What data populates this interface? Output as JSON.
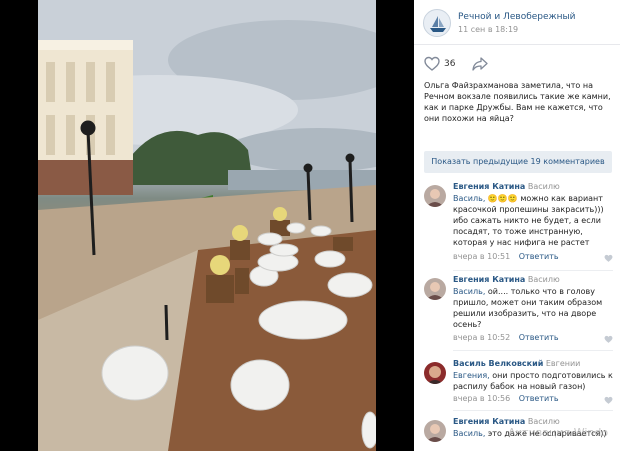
{
  "post": {
    "group_name": "Речной и Левобережный",
    "date": "11 сен в 18:19",
    "likes": "36",
    "text": "Ольга Файзрахманова заметила, что на Речном вокзале появились такие же камни, как и парке Дружбы. Вам не кажется, что они похожи на яйца?"
  },
  "comments_section": {
    "show_previous": "Показать предыдущие 19 комментариев",
    "items": [
      {
        "author": "Евгения Катина",
        "reply_to": "Василю",
        "mention": "Василь,",
        "text": "🙂🙂🙂 можно как вариант красочкой пропешины закрасить))) ибо сажать никто не будет, а если посадят, то тоже инстранную, которая у нас нифига не растет",
        "time": "вчера в 10:51",
        "answer": "Ответить"
      },
      {
        "author": "Евгения Катина",
        "reply_to": "Василю",
        "mention": "Василь,",
        "text": "ой.... только что в голову пришло, может они таким образом решили изобразить, что на дворе осень?",
        "time": "вчера в 10:52",
        "answer": "Ответить"
      },
      {
        "author": "Василь Велковский",
        "reply_to": "Евгении",
        "mention": "Евгения,",
        "text": "они просто подготовились к распилу бабок на новый газон)",
        "time": "вчера в 10:56",
        "answer": "Ответить"
      },
      {
        "author": "Евгения Катина",
        "reply_to": "Василю",
        "mention": "Василь,",
        "text": "это даже не оспаривается))",
        "time": "",
        "answer": ""
      }
    ]
  },
  "watermark": "Активация Windo",
  "colors": {
    "link": "#2a5885",
    "muted": "#939393",
    "panel_bg": "#ffffff",
    "button_bg": "#e8edf2"
  },
  "icons": [
    "like-heart-icon",
    "share-arrow-icon",
    "comment-like-icon",
    "group-avatar"
  ]
}
